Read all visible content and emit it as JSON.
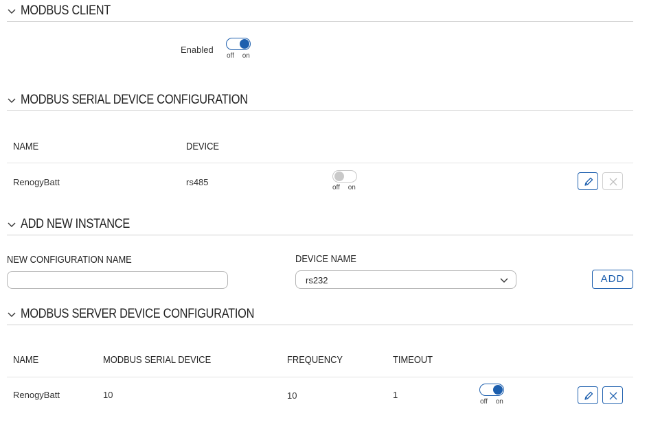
{
  "modbus_client": {
    "title": "MODBUS CLIENT",
    "enabled_label": "Enabled",
    "toggle": {
      "state": "on",
      "off_label": "off",
      "on_label": "on"
    }
  },
  "serial_config": {
    "title": "MODBUS SERIAL DEVICE CONFIGURATION",
    "columns": [
      "NAME",
      "DEVICE"
    ],
    "rows": [
      {
        "name": "RenogyBatt",
        "device": "rs485",
        "toggle": {
          "state": "off",
          "off_label": "off",
          "on_label": "on"
        }
      }
    ]
  },
  "add_instance": {
    "title": "ADD NEW INSTANCE",
    "config_name_label": "NEW CONFIGURATION NAME",
    "config_name_value": "",
    "device_name_label": "DEVICE NAME",
    "device_name_value": "rs232",
    "add_button": "ADD"
  },
  "server_config": {
    "title": "MODBUS SERVER DEVICE CONFIGURATION",
    "columns": [
      "NAME",
      "MODBUS SERIAL DEVICE",
      "FREQUENCY",
      "TIMEOUT"
    ],
    "rows": [
      {
        "name": "RenogyBatt",
        "serial_device": "10",
        "frequency": "10",
        "timeout": "1",
        "toggle": {
          "state": "on",
          "off_label": "off",
          "on_label": "on"
        }
      }
    ]
  },
  "colors": {
    "accent": "#1d5fae",
    "divider": "#cfcfcf",
    "disabled": "#c9c9c9"
  },
  "icons": [
    "chevron-down-icon",
    "pencil-icon",
    "close-icon"
  ]
}
